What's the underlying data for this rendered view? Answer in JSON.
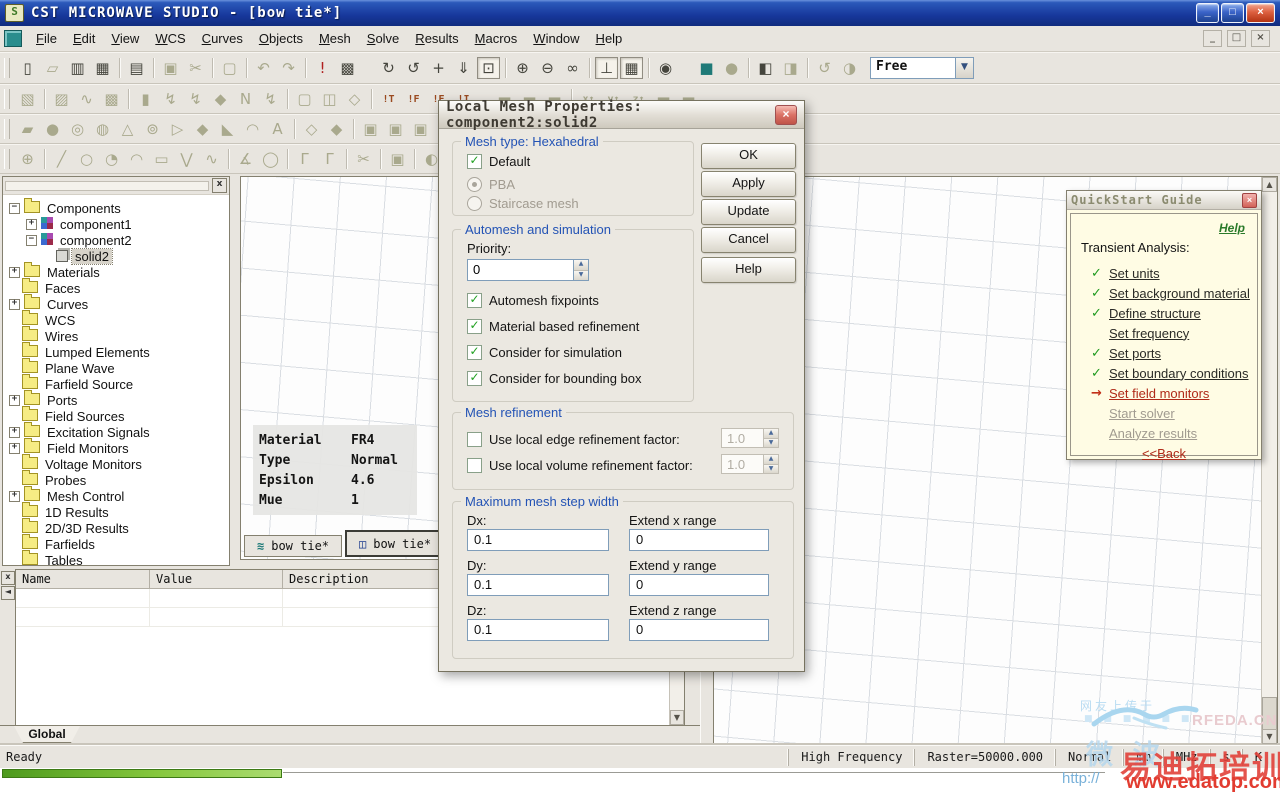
{
  "window": {
    "title": "CST MICROWAVE STUDIO - [bow tie*]",
    "buttons": {
      "minimize": "_",
      "restore": "□",
      "close": "×"
    }
  },
  "menu": {
    "items": [
      "File",
      "Edit",
      "View",
      "WCS",
      "Curves",
      "Objects",
      "Mesh",
      "Solve",
      "Results",
      "Macros",
      "Window",
      "Help"
    ]
  },
  "toolbar_combo": {
    "value": "Free"
  },
  "toolbars": [
    [
      {
        "n": "new-file-icon",
        "g": "▯"
      },
      {
        "n": "open-file-icon",
        "g": "▱",
        "st": "d"
      },
      {
        "n": "save-icon",
        "g": "▥"
      },
      {
        "n": "save-all-icon",
        "g": "▦"
      },
      {
        "sep": 1
      },
      {
        "n": "print-icon",
        "g": "▤"
      },
      {
        "sep": 1
      },
      {
        "n": "copy-icon",
        "g": "▣",
        "st": "d"
      },
      {
        "n": "cut-icon",
        "g": "✂",
        "st": "d"
      },
      {
        "sep": 1
      },
      {
        "n": "paste-icon",
        "g": "▢",
        "st": "d"
      },
      {
        "sep": 1
      },
      {
        "n": "undo-icon",
        "g": "↶",
        "st": "d"
      },
      {
        "n": "redo-icon",
        "g": "↷",
        "st": "d"
      },
      {
        "sep": 1
      },
      {
        "n": "check-structure-icon",
        "g": "!",
        "c": "#b02020"
      },
      {
        "n": "macro-icon",
        "g": "▩"
      },
      {
        "gap": 1
      },
      {
        "n": "rotate-view-icon",
        "g": "↻"
      },
      {
        "n": "spin-view-icon",
        "g": "↺"
      },
      {
        "n": "pan-view-icon",
        "g": "+"
      },
      {
        "n": "zoom-arrow-icon",
        "g": "⇓"
      },
      {
        "n": "zoom-window-icon",
        "g": "⊡",
        "st": "p"
      },
      {
        "sep": 1
      },
      {
        "n": "zoom-in-icon",
        "g": "⊕"
      },
      {
        "n": "zoom-out-icon",
        "g": "⊖"
      },
      {
        "n": "view-options-icon",
        "g": "∞"
      },
      {
        "sep": 1
      },
      {
        "n": "axes-toggle-icon",
        "g": "⊥",
        "st": "p"
      },
      {
        "n": "grid-toggle-icon",
        "g": "▦",
        "st": "p"
      },
      {
        "sep": 1
      },
      {
        "n": "globe-icon",
        "g": "◉"
      },
      {
        "gap": 1
      },
      {
        "n": "shaded-solid-icon",
        "g": "■",
        "c": "#1f7a78"
      },
      {
        "n": "wireframe-icon",
        "g": "●",
        "st": "d"
      },
      {
        "sep": 1
      },
      {
        "n": "wcs-local-icon",
        "g": "◧"
      },
      {
        "n": "wcs-global-icon",
        "g": "◨",
        "st": "d"
      },
      {
        "sep": 1
      },
      {
        "n": "rotate-wcs-icon",
        "g": "↺",
        "st": "d"
      },
      {
        "n": "mirror-wcs-icon",
        "g": "◑",
        "st": "d"
      },
      {
        "combo": 1
      }
    ],
    [
      {
        "n": "units-icon",
        "g": "▧",
        "st": "d"
      },
      {
        "sep": 1
      },
      {
        "n": "background-icon",
        "g": "▨",
        "st": "d"
      },
      {
        "n": "signal-icon",
        "g": "∿",
        "st": "d"
      },
      {
        "n": "parameters-icon",
        "g": "▩",
        "st": "d"
      },
      {
        "sep": 1
      },
      {
        "n": "boundary-icon",
        "g": "▮",
        "st": "d"
      },
      {
        "n": "excitation-icon",
        "g": "↯",
        "st": "d"
      },
      {
        "n": "plane-wave-icon",
        "g": "↯",
        "st": "d"
      },
      {
        "n": "probe-icon",
        "g": "◆",
        "st": "d"
      },
      {
        "n": "network-icon",
        "g": "N",
        "st": "d"
      },
      {
        "n": "discharge-icon",
        "g": "↯",
        "st": "d"
      },
      {
        "sep": 1
      },
      {
        "n": "monitor-icon",
        "g": "▢",
        "st": "d"
      },
      {
        "n": "result-plot-icon",
        "g": "◫",
        "st": "d"
      },
      {
        "n": "pick-result-icon",
        "g": "◇",
        "st": "d"
      },
      {
        "sep": 1
      },
      {
        "n": "solver-time-icon",
        "g": "!T",
        "c": "#9a4a20"
      },
      {
        "n": "solver-freq-icon",
        "g": "!F",
        "c": "#9a4a20"
      },
      {
        "n": "solver-eigen-icon",
        "g": "!E",
        "c": "#9a4a20"
      },
      {
        "n": "solver-integral-icon",
        "g": "!I",
        "c": "#9a4a20"
      },
      {
        "gap": 1
      },
      {
        "n": "mesh-view-icon",
        "g": "▬",
        "st": "d"
      },
      {
        "n": "mesh-props-icon",
        "g": "▬",
        "st": "d"
      },
      {
        "n": "mesh-update-icon",
        "g": "▬",
        "st": "d"
      },
      {
        "sep": 1
      },
      {
        "n": "x-cut-icon",
        "g": "x↑",
        "st": "d"
      },
      {
        "n": "y-cut-icon",
        "g": "y↑",
        "st": "d"
      },
      {
        "n": "z-cut-icon",
        "g": "z↑",
        "st": "d"
      },
      {
        "n": "cutplane-icon",
        "g": "▬",
        "st": "d"
      },
      {
        "n": "cutplane2-icon",
        "g": "▬",
        "st": "d"
      }
    ],
    [
      {
        "n": "brick-icon",
        "g": "▰",
        "st": "d"
      },
      {
        "n": "sphere-icon",
        "g": "●",
        "st": "d"
      },
      {
        "n": "torus-icon",
        "g": "◎",
        "st": "d"
      },
      {
        "n": "torus2-icon",
        "g": "◍",
        "st": "d"
      },
      {
        "n": "cone-icon",
        "g": "△",
        "st": "d"
      },
      {
        "n": "cylinder-icon",
        "g": "⊚",
        "st": "d"
      },
      {
        "n": "arrow-tool-icon",
        "g": "▷",
        "st": "d"
      },
      {
        "n": "extrude-icon",
        "g": "◆",
        "st": "d"
      },
      {
        "n": "loft-icon",
        "g": "◣",
        "st": "d"
      },
      {
        "n": "shell-icon",
        "g": "◠",
        "st": "d"
      },
      {
        "n": "text-shape-icon",
        "g": "A",
        "st": "d"
      },
      {
        "sep": 1
      },
      {
        "n": "boolean-add-icon",
        "g": "◇",
        "st": "d"
      },
      {
        "n": "boolean-subtract-icon",
        "g": "◆",
        "st": "d"
      },
      {
        "sep": 1
      },
      {
        "n": "transform-icon",
        "g": "▣",
        "st": "d"
      },
      {
        "n": "align-icon",
        "g": "▣",
        "st": "d"
      },
      {
        "n": "blend-icon",
        "g": "▣",
        "st": "d"
      },
      {
        "n": "slice-icon",
        "g": "▣",
        "st": "d"
      },
      {
        "sep": 1
      },
      {
        "n": "tiny-shape-icon",
        "g": "▫",
        "st": "d"
      }
    ],
    [
      {
        "n": "pick-center-icon",
        "g": "⊕",
        "st": "d"
      },
      {
        "sep": 1
      },
      {
        "n": "line-icon",
        "g": "╱",
        "st": "d"
      },
      {
        "n": "circle-icon",
        "g": "○",
        "st": "d"
      },
      {
        "n": "arc-icon",
        "g": "◔",
        "st": "d"
      },
      {
        "n": "arc2-icon",
        "g": "◠",
        "st": "d"
      },
      {
        "n": "rectangle-icon",
        "g": "▭",
        "st": "d"
      },
      {
        "n": "polyline-icon",
        "g": "⋁",
        "st": "d"
      },
      {
        "n": "spline-icon",
        "g": "∿",
        "st": "d"
      },
      {
        "sep": 1
      },
      {
        "n": "angle-icon",
        "g": "∡",
        "st": "d"
      },
      {
        "n": "ellipse-icon",
        "g": "◯",
        "st": "d"
      },
      {
        "sep": 1
      },
      {
        "n": "trim-icon",
        "g": "Γ",
        "st": "d"
      },
      {
        "n": "trim2-icon",
        "g": "Γ",
        "st": "d"
      },
      {
        "sep": 1
      },
      {
        "n": "curve-cut-icon",
        "g": "✂",
        "st": "d"
      },
      {
        "sep": 1
      },
      {
        "n": "curve-copy-icon",
        "g": "▣",
        "st": "d"
      },
      {
        "sep": 1
      },
      {
        "n": "sweep-icon",
        "g": "◐",
        "st": "d"
      },
      {
        "n": "sweep2-icon",
        "g": "◑",
        "st": "d"
      },
      {
        "n": "sweep3-icon",
        "g": "◒",
        "st": "d"
      }
    ]
  ],
  "tree": {
    "items": [
      {
        "label": "Components",
        "icon": "folder",
        "expander": "minus",
        "indent": 0
      },
      {
        "label": "component1",
        "icon": "comp",
        "expander": "plus",
        "indent": 1
      },
      {
        "label": "component2",
        "icon": "comp",
        "expander": "minus",
        "indent": 1
      },
      {
        "label": "solid2",
        "icon": "cube",
        "expander": null,
        "indent": 2,
        "selected": true
      },
      {
        "label": "Materials",
        "icon": "folder",
        "expander": "plus",
        "indent": 0
      },
      {
        "label": "Faces",
        "icon": "folder",
        "expander": null,
        "indent": 0
      },
      {
        "label": "Curves",
        "icon": "folder",
        "expander": "plus",
        "indent": 0
      },
      {
        "label": "WCS",
        "icon": "folder",
        "expander": null,
        "indent": 0
      },
      {
        "label": "Wires",
        "icon": "folder",
        "expander": null,
        "indent": 0
      },
      {
        "label": "Lumped Elements",
        "icon": "folder",
        "expander": null,
        "indent": 0
      },
      {
        "label": "Plane Wave",
        "icon": "folder",
        "expander": null,
        "indent": 0
      },
      {
        "label": "Farfield Source",
        "icon": "folder",
        "expander": null,
        "indent": 0
      },
      {
        "label": "Ports",
        "icon": "folder",
        "expander": "plus",
        "indent": 0
      },
      {
        "label": "Field Sources",
        "icon": "folder",
        "expander": null,
        "indent": 0
      },
      {
        "label": "Excitation Signals",
        "icon": "folder",
        "expander": "plus",
        "indent": 0
      },
      {
        "label": "Field Monitors",
        "icon": "folder",
        "expander": "plus",
        "indent": 0
      },
      {
        "label": "Voltage Monitors",
        "icon": "folder",
        "expander": null,
        "indent": 0
      },
      {
        "label": "Probes",
        "icon": "folder",
        "expander": null,
        "indent": 0
      },
      {
        "label": "Mesh Control",
        "icon": "folder",
        "expander": "plus",
        "indent": 0
      },
      {
        "label": "1D Results",
        "icon": "folder",
        "expander": null,
        "indent": 0
      },
      {
        "label": "2D/3D Results",
        "icon": "folder",
        "expander": null,
        "indent": 0
      },
      {
        "label": "Farfields",
        "icon": "folder",
        "expander": null,
        "indent": 0
      },
      {
        "label": "Tables",
        "icon": "folder",
        "expander": null,
        "indent": 0
      }
    ]
  },
  "material_table": {
    "rows": [
      [
        "Material",
        "FR4"
      ],
      [
        "Type",
        "Normal"
      ],
      [
        "Epsilon",
        "4.6"
      ],
      [
        "Mue",
        "1"
      ]
    ]
  },
  "view_tabs": [
    {
      "label": "bow tie*",
      "icon": "wave",
      "active": false
    },
    {
      "label": "bow tie*",
      "icon": "cube",
      "active": true
    }
  ],
  "dialog": {
    "title": "Local Mesh Properties: component2:solid2",
    "close": "×",
    "groups": {
      "mesh_type": {
        "label": "Mesh type: Hexahedral",
        "default_label": "Default",
        "pba_label": "PBA",
        "staircase_label": "Staircase mesh"
      },
      "automesh": {
        "label": "Automesh and simulation",
        "priority_label": "Priority:",
        "priority_value": "0",
        "checks": [
          "Automesh fixpoints",
          "Material based refinement",
          "Consider for simulation",
          "Consider for bounding box"
        ]
      },
      "refine": {
        "label": "Mesh refinement",
        "edge_label": "Use local edge refinement factor:",
        "edge_value": "1.0",
        "volume_label": "Use local volume refinement factor:",
        "volume_value": "1.0"
      },
      "step": {
        "label": "Maximum mesh step width",
        "fields": [
          {
            "label": "Dx:",
            "value": "0.1",
            "ext_label": "Extend x range",
            "ext_value": "0"
          },
          {
            "label": "Dy:",
            "value": "0.1",
            "ext_label": "Extend y range",
            "ext_value": "0"
          },
          {
            "label": "Dz:",
            "value": "0.1",
            "ext_label": "Extend z range",
            "ext_value": "0"
          }
        ]
      }
    },
    "buttons": [
      "OK",
      "Apply",
      "Update",
      "Cancel",
      "Help"
    ]
  },
  "quickstart": {
    "title": "QuickStart Guide",
    "close": "×",
    "help": "Help",
    "heading": "Transient Analysis:",
    "steps": [
      {
        "label": "Set units",
        "state": "done"
      },
      {
        "label": "Set background material",
        "state": "done"
      },
      {
        "label": "Define structure",
        "state": "done"
      },
      {
        "label": "Set frequency",
        "state": "todo"
      },
      {
        "label": "Set ports",
        "state": "done"
      },
      {
        "label": "Set boundary conditions",
        "state": "done"
      },
      {
        "label": "Set field monitors",
        "state": "current"
      },
      {
        "label": "Start solver",
        "state": "disabled"
      },
      {
        "label": "Analyze results",
        "state": "disabled"
      }
    ],
    "back": "<<Back"
  },
  "param_panel": {
    "columns": [
      "Name",
      "Value",
      "Description"
    ],
    "tab": "Global"
  },
  "status": {
    "ready": "Ready",
    "segments": [
      "High Frequency",
      "Raster=50000.000",
      "Normal",
      "mm",
      "MHz",
      "s",
      "K"
    ]
  },
  "watermark": {
    "upload": "网友上传于",
    "dots": "■ ■ ■ ■ ■ ■",
    "rfeda": "RFEDA.CN",
    "wave": "微 波",
    "cn": "易迪拓培训",
    "http": "http://",
    "site": "www.edatop.com"
  },
  "colors": {
    "accent_blue": "#2353b5",
    "check_green": "#21a121",
    "current_red": "#b02a18",
    "watermark_red": "#e2423a"
  }
}
